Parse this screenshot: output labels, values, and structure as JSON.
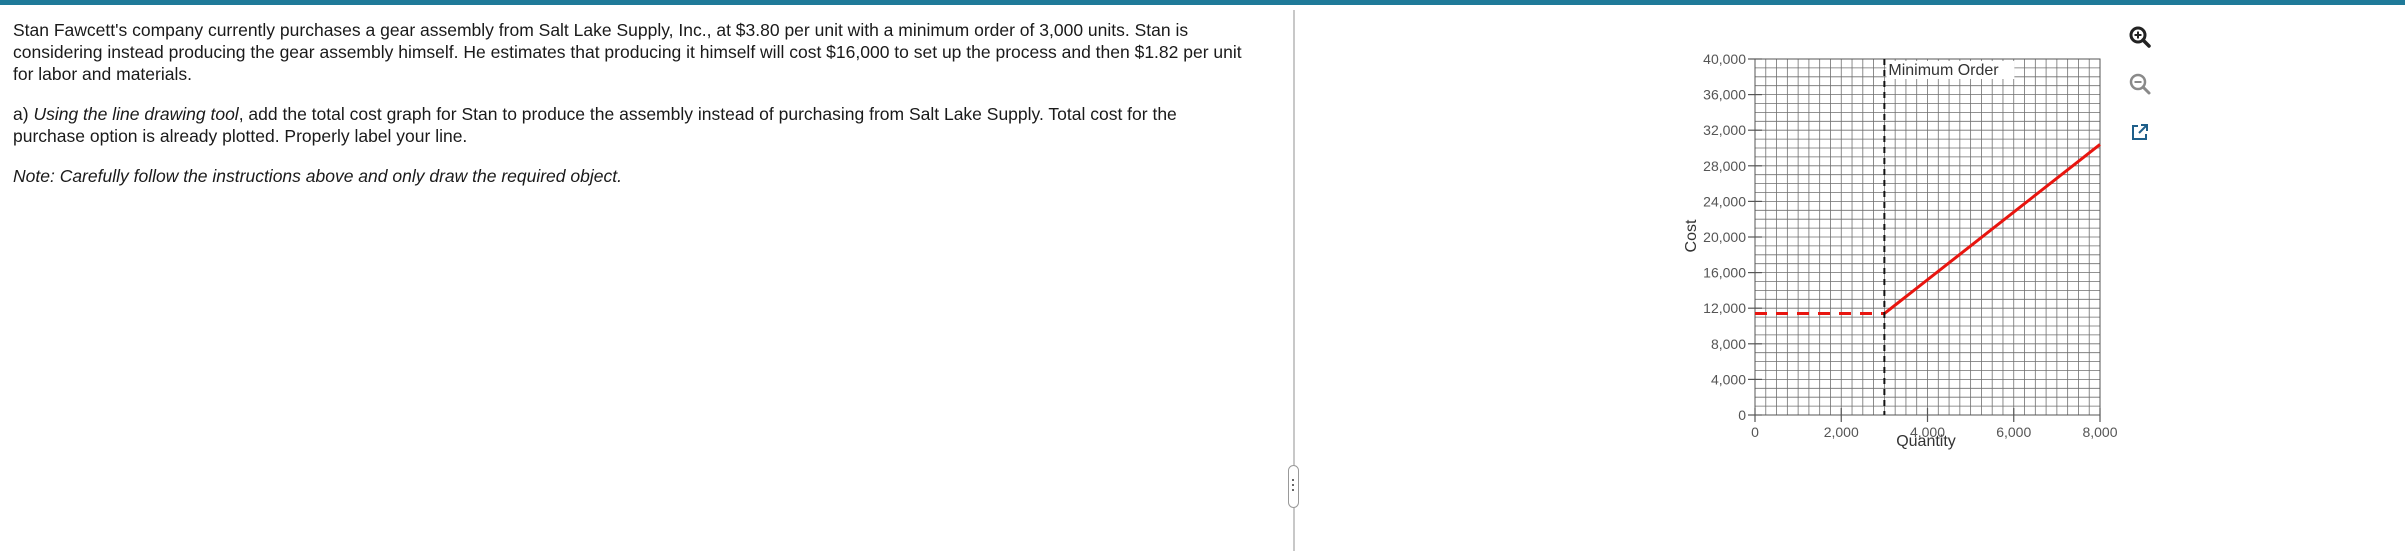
{
  "question": {
    "intro": "Stan Fawcett's company currently purchases a gear assembly from Salt Lake Supply, Inc., at $3.80 per unit with a minimum order of 3,000 units. Stan is considering instead producing the gear assembly himself. He estimates that producing it himself will cost $16,000 to set up the process and then $1.82 per unit for labor and materials.",
    "part_a_prefix": "a) ",
    "part_a_italic": "Using the line drawing tool",
    "part_a_rest": ", add the total cost graph for Stan to produce the assembly instead of purchasing from Salt Lake Supply.  Total cost for the purchase option is already plotted. Properly label your line.",
    "note": "Note: Carefully follow the instructions above and only draw the required object."
  },
  "tools": {
    "zoom_in_icon": "zoom-in-icon",
    "zoom_out_icon": "zoom-out-icon",
    "popout_icon": "external-link-icon"
  },
  "chart_data": {
    "type": "line",
    "xlabel": "Quantity",
    "ylabel": "Cost",
    "xlim": [
      0,
      8000
    ],
    "ylim": [
      0,
      40000
    ],
    "x_ticks": [
      0,
      2000,
      4000,
      6000,
      8000
    ],
    "x_tick_labels": [
      "0",
      "2,000",
      "4,000",
      "6,000",
      "8,000"
    ],
    "y_ticks": [
      0,
      4000,
      8000,
      12000,
      16000,
      20000,
      24000,
      28000,
      32000,
      36000,
      40000
    ],
    "y_tick_labels": [
      "0",
      "4,000",
      "8,000",
      "12,000",
      "16,000",
      "20,000",
      "24,000",
      "28,000",
      "32,000",
      "36,000",
      "40,000"
    ],
    "x_minor_step": 250,
    "y_minor_step": 1000,
    "grid": true,
    "colors": {
      "purchase": "#e8150f",
      "axis": "#555555",
      "grid": "#6f6f6f",
      "marker": "#111111"
    },
    "series": [
      {
        "style": "dashed",
        "points": [
          [
            0,
            11400
          ],
          [
            3000,
            11400
          ]
        ]
      },
      {
        "style": "solid",
        "points": [
          [
            3000,
            11400
          ],
          [
            8000,
            30400
          ]
        ]
      }
    ],
    "annotations": [
      {
        "text": "Minimum Order",
        "x": 3000,
        "style": "dashed-vertical"
      }
    ]
  }
}
